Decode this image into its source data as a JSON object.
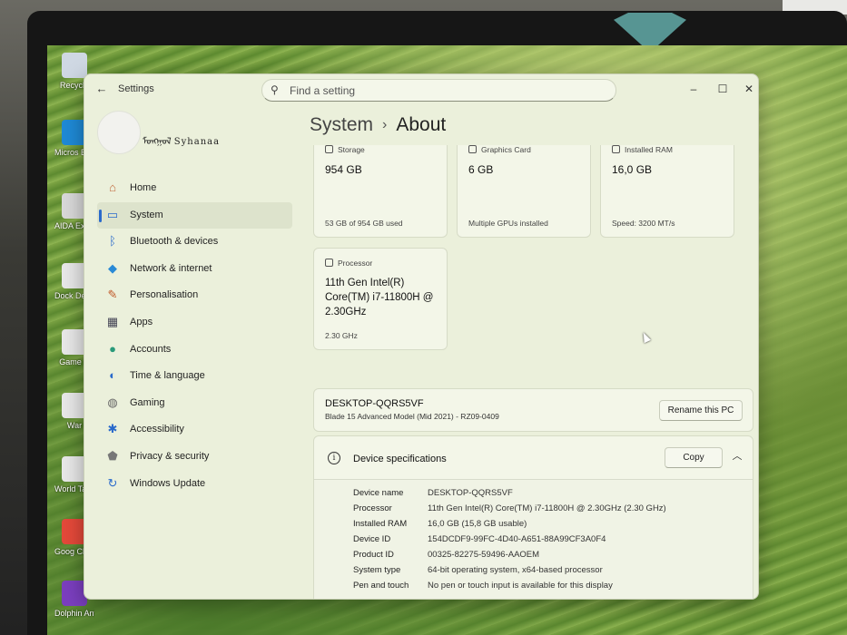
{
  "window": {
    "title": "Settings"
  },
  "search": {
    "placeholder": "Find a setting"
  },
  "window_controls": {
    "minimize": "–",
    "maximize": "☐",
    "close": "✕"
  },
  "profile": {
    "name": "ᠮᠣᠩᠭᠣᠯ Syhanaa"
  },
  "sidebar": {
    "items": [
      {
        "label": "Home",
        "icon": "home-icon"
      },
      {
        "label": "System",
        "icon": "monitor-icon"
      },
      {
        "label": "Bluetooth & devices",
        "icon": "bluetooth-icon"
      },
      {
        "label": "Network & internet",
        "icon": "wifi-icon"
      },
      {
        "label": "Personalisation",
        "icon": "brush-icon"
      },
      {
        "label": "Apps",
        "icon": "apps-icon"
      },
      {
        "label": "Accounts",
        "icon": "person-icon"
      },
      {
        "label": "Time & language",
        "icon": "globe-clock-icon"
      },
      {
        "label": "Gaming",
        "icon": "gamepad-icon"
      },
      {
        "label": "Accessibility",
        "icon": "accessibility-icon"
      },
      {
        "label": "Privacy & security",
        "icon": "shield-icon"
      },
      {
        "label": "Windows Update",
        "icon": "update-icon"
      }
    ],
    "active_index": 1
  },
  "breadcrumb": {
    "parent": "System",
    "separator": "›",
    "current": "About"
  },
  "cards": {
    "storage": {
      "label": "Storage",
      "value": "954 GB",
      "sub": "53 GB of 954 GB used"
    },
    "graphics": {
      "label": "Graphics Card",
      "value": "6 GB",
      "sub": "Multiple GPUs installed"
    },
    "ram": {
      "label": "Installed RAM",
      "value": "16,0 GB",
      "sub": "Speed: 3200 MT/s"
    },
    "processor": {
      "label": "Processor",
      "value": "11th Gen Intel(R) Core(TM) i7-11800H @ 2.30GHz",
      "sub": "2.30 GHz"
    }
  },
  "pc": {
    "name": "DESKTOP-QQRS5VF",
    "model": "Blade 15 Advanced Model (Mid 2021) - RZ09-0409",
    "rename_label": "Rename this PC"
  },
  "device_specs": {
    "title": "Device specifications",
    "copy_label": "Copy",
    "rows": [
      {
        "key": "Device name",
        "value": "DESKTOP-QQRS5VF"
      },
      {
        "key": "Processor",
        "value": "11th Gen Intel(R) Core(TM) i7-11800H @ 2.30GHz (2.30 GHz)"
      },
      {
        "key": "Installed RAM",
        "value": "16,0 GB (15,8 GB usable)"
      },
      {
        "key": "Device ID",
        "value": "154DCDF9-99FC-4D40-A651-88A99CF3A0F4"
      },
      {
        "key": "Product ID",
        "value": "00325-82275-59496-AAOEM"
      },
      {
        "key": "System type",
        "value": "64-bit operating system, x64-based processor"
      },
      {
        "key": "Pen and touch",
        "value": "No pen or touch input is available for this display"
      }
    ]
  },
  "desktop_icons": [
    {
      "label": "Recycle",
      "color": "#cfd8e3"
    },
    {
      "label": "Micros Edg",
      "color": "#1f8ad6"
    },
    {
      "label": "AIDA Extre",
      "color": "#d9d9d9"
    },
    {
      "label": "Dock Deskt",
      "color": "#e8e8e8"
    },
    {
      "label": "Game C",
      "color": "#e8e8e8"
    },
    {
      "label": "War",
      "color": "#e8e8e8"
    },
    {
      "label": "World Tanks",
      "color": "#e8e8e8"
    },
    {
      "label": "Goog Chro",
      "color": "#e5493a"
    },
    {
      "label": "Dolphin Anty",
      "color": "#7b3fbf"
    }
  ]
}
